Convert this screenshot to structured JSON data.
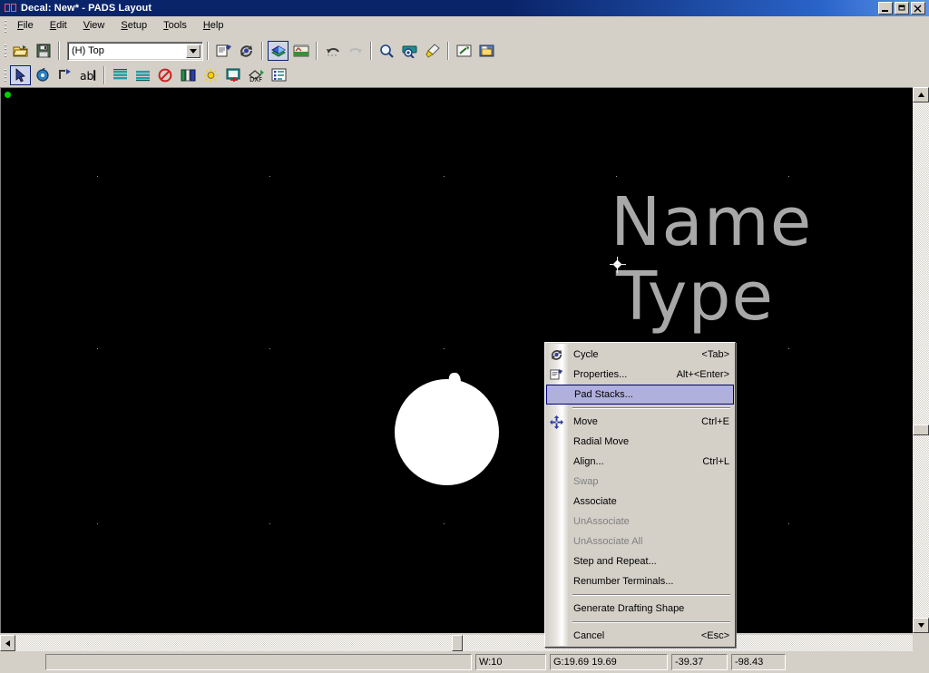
{
  "window": {
    "title": "Decal: New* - PADS Layout",
    "icon": "decal-icon",
    "buttons": {
      "minimize": "minimize-button",
      "restore": "restore-button",
      "close": "close-button"
    }
  },
  "menubar": {
    "items": [
      {
        "label": "File",
        "mnemonic": "F"
      },
      {
        "label": "Edit",
        "mnemonic": "E"
      },
      {
        "label": "View",
        "mnemonic": "V"
      },
      {
        "label": "Setup",
        "mnemonic": "S"
      },
      {
        "label": "Tools",
        "mnemonic": "T"
      },
      {
        "label": "Help",
        "mnemonic": "H"
      }
    ]
  },
  "toolbar_standard": {
    "layer_combo": {
      "value": "(H) Top"
    },
    "items": [
      {
        "name": "open-icon",
        "title": "Open"
      },
      {
        "name": "save-icon",
        "title": "Save"
      },
      {
        "name": "properties-icon",
        "title": "Properties"
      },
      {
        "name": "cycle-icon",
        "title": "Cycle"
      },
      {
        "name": "layers-icon",
        "title": "Display Colors",
        "pressed": true
      },
      {
        "name": "drafting-icon",
        "title": "Drafting"
      },
      {
        "name": "undo-icon",
        "title": "Undo"
      },
      {
        "name": "redo-icon",
        "title": "Redo",
        "disabled": true
      },
      {
        "name": "zoom-icon",
        "title": "Zoom"
      },
      {
        "name": "zoom-area-icon",
        "title": "Zoom Area"
      },
      {
        "name": "highlight-brush-icon",
        "title": "Highlight"
      },
      {
        "name": "pour-manager-icon",
        "title": "Pour Manager"
      },
      {
        "name": "library-icon",
        "title": "Library"
      }
    ]
  },
  "toolbar_drafting": {
    "items": [
      {
        "name": "select-arrow-icon",
        "title": "Select",
        "pressed": true
      },
      {
        "name": "add-terminal-icon",
        "title": "Add Terminal"
      },
      {
        "name": "add-2d-line-icon",
        "title": "Add 2D Line"
      },
      {
        "name": "add-text-icon",
        "title": "Add Text"
      },
      {
        "name": "copper-icon",
        "title": "Copper"
      },
      {
        "name": "copper-pour-icon",
        "title": "Copper Pour"
      },
      {
        "name": "no-pour-icon",
        "title": "Keepout"
      },
      {
        "name": "board-outline-icon",
        "title": "Board Outline"
      },
      {
        "name": "flash-icon",
        "title": "Flash"
      },
      {
        "name": "decal-wizard-icon",
        "title": "Decal Wizard"
      },
      {
        "name": "dxf-icon",
        "title": "DXF"
      },
      {
        "name": "report-icon",
        "title": "Report"
      }
    ]
  },
  "canvas": {
    "decal_labels": {
      "name": "Name",
      "type": "Type"
    },
    "origin_marker": "origin-dot",
    "pad_shape": "round-pad-with-tab",
    "background_color": "#000000",
    "label_color": "#a8a8a8"
  },
  "context_menu": {
    "items": [
      {
        "label": "Cycle",
        "accel": "<Tab>",
        "icon": "cycle-icon",
        "state": "normal"
      },
      {
        "label": "Properties...",
        "accel": "Alt+<Enter>",
        "icon": "properties-icon",
        "state": "normal"
      },
      {
        "label": "Pad Stacks...",
        "accel": "",
        "icon": "",
        "state": "selected"
      },
      {
        "separator": true
      },
      {
        "label": "Move",
        "accel": "Ctrl+E",
        "icon": "move-icon",
        "state": "normal"
      },
      {
        "label": "Radial Move",
        "accel": "",
        "icon": "",
        "state": "normal"
      },
      {
        "label": "Align...",
        "accel": "Ctrl+L",
        "icon": "",
        "state": "normal"
      },
      {
        "label": "Swap",
        "accel": "",
        "icon": "",
        "state": "disabled"
      },
      {
        "label": "Associate",
        "accel": "",
        "icon": "",
        "state": "normal"
      },
      {
        "label": "UnAssociate",
        "accel": "",
        "icon": "",
        "state": "disabled"
      },
      {
        "label": "UnAssociate All",
        "accel": "",
        "icon": "",
        "state": "disabled"
      },
      {
        "label": "Step and Repeat...",
        "accel": "",
        "icon": "",
        "state": "normal"
      },
      {
        "label": "Renumber Terminals...",
        "accel": "",
        "icon": "",
        "state": "normal"
      },
      {
        "separator": true
      },
      {
        "label": "Generate Drafting Shape",
        "accel": "",
        "icon": "",
        "state": "normal"
      },
      {
        "separator": true
      },
      {
        "label": "Cancel",
        "accel": "<Esc>",
        "icon": "",
        "state": "normal"
      }
    ],
    "highlight_fill": "#b0b0dc",
    "highlight_border": "#000080"
  },
  "statusbar": {
    "message": "",
    "width_field": "W:10",
    "grid_field": "G:19.69 19.69",
    "x_coordinate": "-39.37",
    "y_coordinate": "-98.43"
  }
}
